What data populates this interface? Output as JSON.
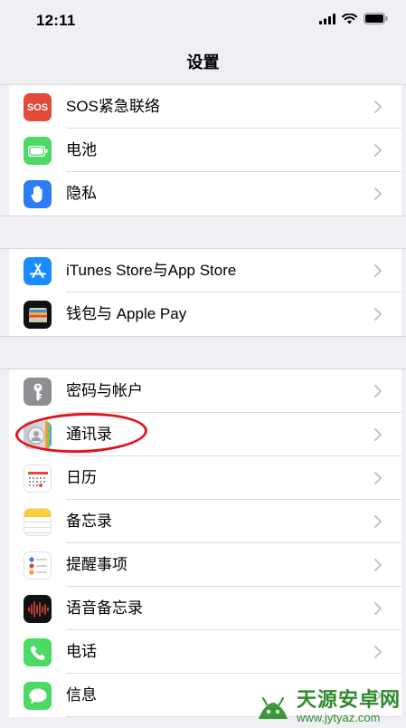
{
  "status_bar": {
    "time": "12:11"
  },
  "nav": {
    "title": "设置"
  },
  "groups": [
    {
      "items": [
        {
          "label": "SOS紧急联络",
          "icon": "sos-icon",
          "icon_text": "SOS",
          "color": "#e24a3b"
        },
        {
          "label": "电池",
          "icon": "battery-icon",
          "color": "#4cd964"
        },
        {
          "label": "隐私",
          "icon": "hand-icon",
          "color": "#2d7cf6"
        }
      ]
    },
    {
      "items": [
        {
          "label": "iTunes Store与App Store",
          "icon": "app-store-icon",
          "color": "#1a8cff"
        },
        {
          "label": "钱包与 Apple Pay",
          "icon": "wallet-icon",
          "color": "#111111"
        }
      ]
    },
    {
      "items": [
        {
          "label": "密码与帐户",
          "icon": "key-icon",
          "color": "#8e8e93"
        },
        {
          "label": "通讯录",
          "icon": "contacts-icon",
          "color": "#c8c8cc"
        },
        {
          "label": "日历",
          "icon": "calendar-icon",
          "color": "#ffffff"
        },
        {
          "label": "备忘录",
          "icon": "notes-icon",
          "color": "#ffcc33"
        },
        {
          "label": "提醒事项",
          "icon": "reminders-icon",
          "color": "#ffffff"
        },
        {
          "label": "语音备忘录",
          "icon": "voice-memo-icon",
          "color": "#111111"
        },
        {
          "label": "电话",
          "icon": "phone-icon",
          "color": "#4cd964"
        },
        {
          "label": "信息",
          "icon": "messages-icon",
          "color": "#4cd964"
        }
      ]
    }
  ],
  "watermark": {
    "title": "天源安卓网",
    "url": "www.jytyaz.com"
  }
}
